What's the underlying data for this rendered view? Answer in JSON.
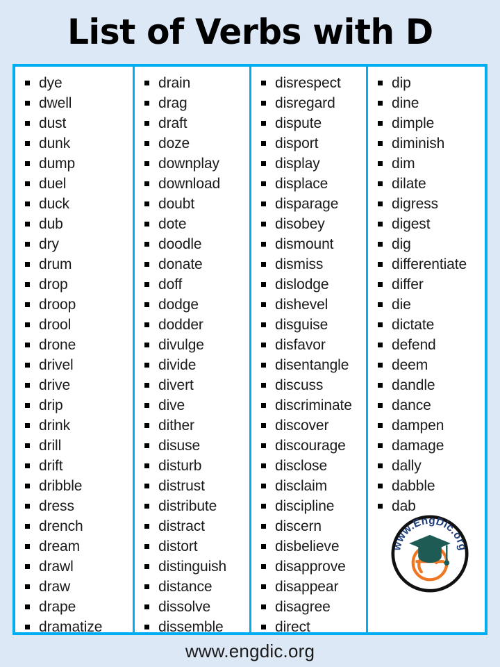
{
  "page": {
    "background_color": "#dce8f5",
    "accent_color": "#00aeef",
    "text_color": "#1a1a1a"
  },
  "header": {
    "title": "List of Verbs with D"
  },
  "footer": {
    "website": "www.engdic.org"
  },
  "logo": {
    "alt_name": "engdic-logo",
    "curved_text": "www.EngDic.org",
    "letter": "e",
    "cap_color": "#1e5b55",
    "letter_color": "#ef7622",
    "text_color": "#1f3f7a"
  },
  "table": {
    "columns": [
      {
        "id": "column-1",
        "words": [
          "dye",
          "dwell",
          "dust",
          "dunk",
          "dump",
          "duel",
          "duck",
          "dub",
          "dry",
          "drum",
          "drop",
          "droop",
          "drool",
          "drone",
          "drivel",
          "drive",
          "drip",
          "drink",
          "drill",
          "drift",
          "dribble",
          "dress",
          "drench",
          "dream",
          "drawl",
          "draw",
          "drape",
          "dramatize"
        ]
      },
      {
        "id": "column-2",
        "words": [
          "drain",
          "drag",
          "draft",
          "doze",
          "downplay",
          "download",
          "doubt",
          "dote",
          "doodle",
          "donate",
          "doff",
          "dodge",
          "dodder",
          "divulge",
          "divide",
          "divert",
          "dive",
          "dither",
          "disuse",
          "disturb",
          "distrust",
          "distribute",
          "distract",
          "distort",
          "distinguish",
          "distance",
          "dissolve",
          "dissemble"
        ]
      },
      {
        "id": "column-3",
        "words": [
          "disrespect",
          "disregard",
          "dispute",
          "disport",
          "display",
          "displace",
          "disparage",
          "disobey",
          "dismount",
          "dismiss",
          "dislodge",
          "dishevel",
          "disguise",
          "disfavor",
          "disentangle",
          "discuss",
          "discriminate",
          "discover",
          "discourage",
          "disclose",
          "disclaim",
          "discipline",
          "discern",
          "disbelieve",
          "disapprove",
          "disappear",
          "disagree",
          "direct"
        ]
      },
      {
        "id": "column-4",
        "words": [
          "dip",
          "dine",
          "dimple",
          "diminish",
          "dim",
          "dilate",
          "digress",
          "digest",
          "dig",
          "differentiate",
          "differ",
          "die",
          "dictate",
          "defend",
          "deem",
          "dandle",
          "dance",
          "dampen",
          "damage",
          "dally",
          "dabble",
          "dab"
        ]
      }
    ]
  }
}
